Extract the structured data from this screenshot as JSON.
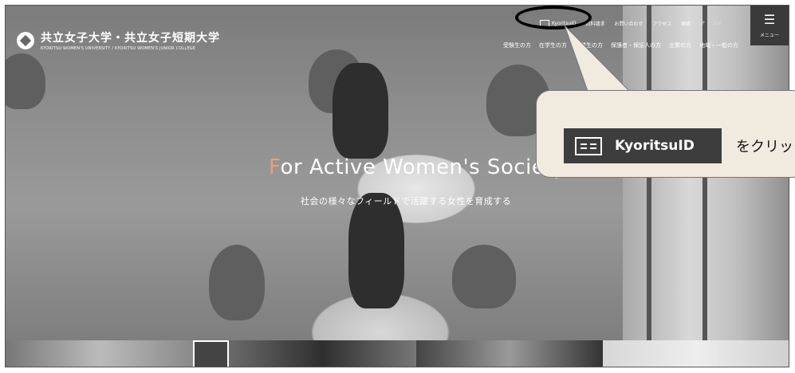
{
  "site": {
    "name": "共立女子大学・共立女子短期大学",
    "subname": "KYORITSU WOMEN'S UNIVERSITY / KYORITSU WOMEN'S JUNIOR COLLEGE"
  },
  "topnav": {
    "kyoritsuid": "KyoritsuID",
    "request": "資料請求",
    "contact": "お問い合わせ",
    "access": "アクセス",
    "search": "検索",
    "lang_jp": "JP",
    "lang_en": "EN"
  },
  "menu": {
    "label": "メニュー"
  },
  "mainnav": [
    "受験生の方",
    "在学生の方",
    "卒業生の方",
    "保護者・保証人の方",
    "企業の方",
    "地域・一般の方"
  ],
  "hero": {
    "headline_first": "F",
    "headline_rest": "or Active Women's Society",
    "subline": "社会の様々なフィールドで活躍する女性を育成する"
  },
  "callout": {
    "badge_text": "KyoritsuID",
    "instruction": "をクリック"
  }
}
